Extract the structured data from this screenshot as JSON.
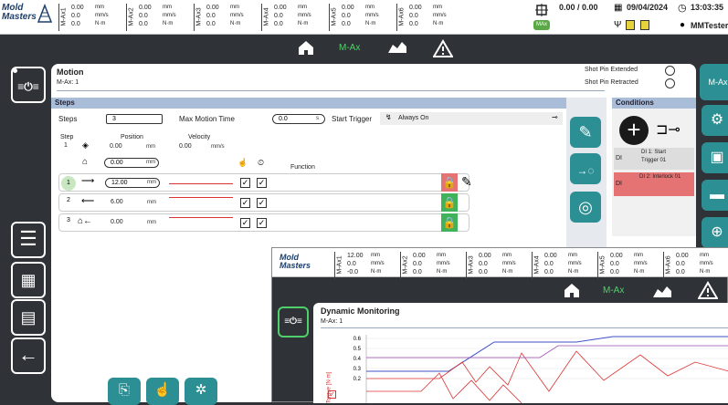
{
  "topbar": {
    "logo_line1": "Mold",
    "logo_line2": "Masters",
    "axes": [
      {
        "name": "M-Ax1",
        "v1": "0.00",
        "v2": "0.0",
        "v3": "0.0",
        "u1": "mm",
        "u2": "mm/s",
        "u3": "N·m"
      },
      {
        "name": "M-Ax2",
        "v1": "0.00",
        "v2": "0.0",
        "v3": "0.0",
        "u1": "mm",
        "u2": "mm/s",
        "u3": "N·m"
      },
      {
        "name": "M-Ax3",
        "v1": "0.00",
        "v2": "0.0",
        "v3": "0.0",
        "u1": "mm",
        "u2": "mm/s",
        "u3": "N·m"
      },
      {
        "name": "M-Ax4",
        "v1": "0.00",
        "v2": "0.0",
        "v3": "0.0",
        "u1": "mm",
        "u2": "mm/s",
        "u3": "N·m"
      },
      {
        "name": "M-Ax5",
        "v1": "0.00",
        "v2": "0.0",
        "v3": "0.0",
        "u1": "mm",
        "u2": "mm/s",
        "u3": "N·m"
      },
      {
        "name": "M-Ax6",
        "v1": "0.00",
        "v2": "0.0",
        "v3": "0.0",
        "u1": "mm",
        "u2": "mm/s",
        "u3": "N·m"
      }
    ],
    "max_label": "MAx",
    "counter": "0.00 / 0.00",
    "date": "09/04/2024",
    "time": "13:03:35",
    "user": "MMTester"
  },
  "nav": {
    "center_label": "M-Ax"
  },
  "right_rail": {
    "label": "M-Ax"
  },
  "motion": {
    "title": "Motion",
    "subtitle": "M-Ax: 1",
    "shot_pin_extended": "Shot Pin Extended",
    "shot_pin_retracted": "Shot Pin Retracted",
    "steps_section": "Steps",
    "steps_label": "Steps",
    "steps_value": "3",
    "max_motion_time_label": "Max Motion Time",
    "max_motion_time_value": "0.0",
    "max_motion_time_unit": "s",
    "start_trigger_label": "Start Trigger",
    "start_trigger_value": "Always On",
    "col_step": "Step",
    "col_position": "Position",
    "col_velocity": "Velocity",
    "current_step": "1",
    "current_position": "0.00",
    "current_position_unit": "mm",
    "current_velocity": "0.00",
    "current_velocity_unit": "mm/s",
    "home_position": "0.00",
    "home_unit": "mm",
    "function_label": "Function",
    "rows": [
      {
        "step": "1",
        "position": "12.00",
        "unit": "mm"
      },
      {
        "step": "2",
        "position": "6.00",
        "unit": "mm"
      },
      {
        "step": "3",
        "position": "0.00",
        "unit": "mm"
      }
    ]
  },
  "conditions": {
    "header": "Conditions",
    "item1_line1": "DI 1: Start",
    "item1_line2": "Trigger 01",
    "item1_tag": "DI",
    "item2_line1": "DI 2: Interlock 01",
    "item2_tag": "DI"
  },
  "overlay": {
    "logo_line1": "Mold",
    "logo_line2": "Masters",
    "axes": [
      {
        "name": "M-Ax1",
        "v1": "12.00",
        "v2": "0.0",
        "v3": "-0.0",
        "u1": "mm",
        "u2": "mm/s",
        "u3": "N·m"
      },
      {
        "name": "M-Ax2",
        "v1": "0.00",
        "v2": "0.0",
        "v3": "0.0",
        "u1": "mm",
        "u2": "mm/s",
        "u3": "N·m"
      },
      {
        "name": "M-Ax3",
        "v1": "0.00",
        "v2": "0.0",
        "v3": "0.0",
        "u1": "mm",
        "u2": "mm/s",
        "u3": "N·m"
      },
      {
        "name": "M-Ax4",
        "v1": "0.00",
        "v2": "0.0",
        "v3": "0.0",
        "u1": "mm",
        "u2": "mm/s",
        "u3": "N·m"
      },
      {
        "name": "M-Ax5",
        "v1": "0.00",
        "v2": "0.0",
        "v3": "0.0",
        "u1": "mm",
        "u2": "mm/s",
        "u3": "N·m"
      },
      {
        "name": "M-Ax6",
        "v1": "0.00",
        "v2": "0.0",
        "v3": "0.0",
        "u1": "mm",
        "u2": "mm/s",
        "u3": "N·m"
      }
    ],
    "nav_label": "M-Ax",
    "title": "Dynamic Monitoring",
    "subtitle": "M-Ax: 1",
    "ylabel": "Torque [N·m]",
    "yticks": [
      "0.6",
      "0.5",
      "0.4",
      "0.3",
      "0.2"
    ]
  },
  "colors": {
    "teal": "#2c8f93",
    "dark": "#2f3337",
    "green": "#40b35a",
    "red": "#e57373",
    "section": "#a9bdd8"
  }
}
